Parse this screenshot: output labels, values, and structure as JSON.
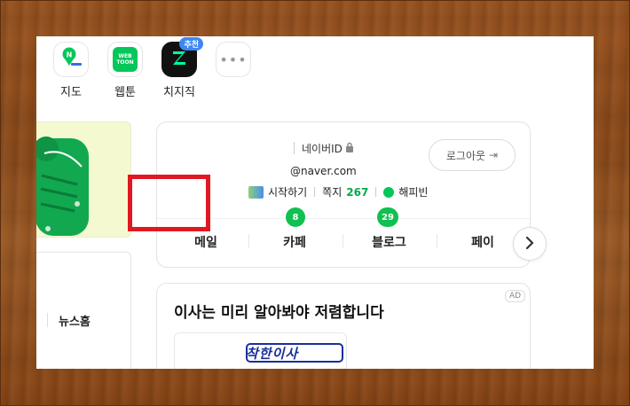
{
  "apps": [
    {
      "label": "지도",
      "icon": "map-icon"
    },
    {
      "label": "웹툰",
      "icon": "webtoon-icon",
      "icon_text_top": "WEB",
      "icon_text_bottom": "TOON"
    },
    {
      "label": "치지직",
      "icon": "chzzk-icon",
      "badge": "추천"
    },
    {
      "label": "",
      "icon": "more-icon"
    }
  ],
  "profile": {
    "naver_id": "네이버ID",
    "email": "@naver.com",
    "logout": "로그아웃",
    "start_label": "시작하기",
    "note_label": "쪽지",
    "note_count": "267",
    "happybean": "해피빈",
    "tabs": [
      {
        "label": "메일",
        "count": ""
      },
      {
        "label": "카페",
        "count": "8"
      },
      {
        "label": "블로그",
        "count": "29"
      },
      {
        "label": "페이",
        "count": ""
      }
    ]
  },
  "news_home": "뉴스홈",
  "ad": {
    "badge": "AD",
    "title": "이사는 미리 알아봐야 저렴합니다",
    "logo_text": "착한이사"
  },
  "colors": {
    "accent_green": "#03c75a",
    "count_text_green": "#03a94d",
    "highlight_red": "#e01822"
  }
}
